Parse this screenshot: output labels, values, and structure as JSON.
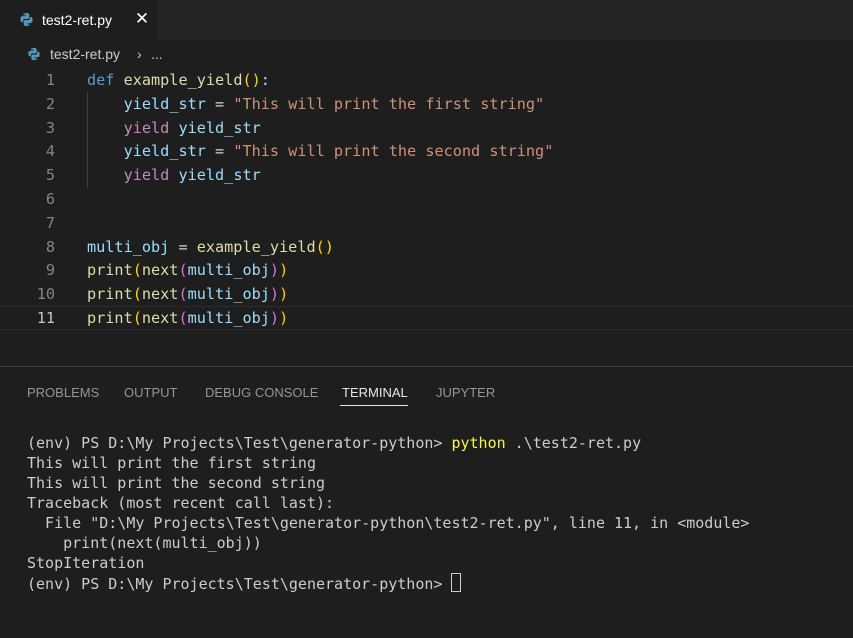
{
  "tab": {
    "label": "test2-ret.py",
    "close_glyph": "✕",
    "icon": "python-icon"
  },
  "breadcrumb": {
    "file": "test2-ret.py",
    "separator": "›",
    "more": "..."
  },
  "editor": {
    "line_numbers": [
      "1",
      "2",
      "3",
      "4",
      "5",
      "6",
      "7",
      "8",
      "9",
      "10",
      "11"
    ],
    "active_line": "11",
    "lines": [
      [
        [
          "kw-def",
          "def"
        ],
        [
          "op",
          " "
        ],
        [
          "fn",
          "example_yield"
        ],
        [
          "br1",
          "()"
        ],
        [
          "op",
          ":"
        ]
      ],
      [
        [
          "op",
          "    "
        ],
        [
          "var",
          "yield_str"
        ],
        [
          "op",
          " = "
        ],
        [
          "str",
          "\"This will print the first string\""
        ]
      ],
      [
        [
          "op",
          "    "
        ],
        [
          "kw-flow",
          "yield"
        ],
        [
          "op",
          " "
        ],
        [
          "var",
          "yield_str"
        ]
      ],
      [
        [
          "op",
          "    "
        ],
        [
          "var",
          "yield_str"
        ],
        [
          "op",
          " = "
        ],
        [
          "str",
          "\"This will print the second string\""
        ]
      ],
      [
        [
          "op",
          "    "
        ],
        [
          "kw-flow",
          "yield"
        ],
        [
          "op",
          " "
        ],
        [
          "var",
          "yield_str"
        ]
      ],
      [],
      [],
      [
        [
          "var",
          "multi_obj"
        ],
        [
          "op",
          " = "
        ],
        [
          "fn",
          "example_yield"
        ],
        [
          "br1",
          "()"
        ]
      ],
      [
        [
          "fn",
          "print"
        ],
        [
          "br1",
          "("
        ],
        [
          "fn",
          "next"
        ],
        [
          "br2",
          "("
        ],
        [
          "var",
          "multi_obj"
        ],
        [
          "br2",
          ")"
        ],
        [
          "br1",
          ")"
        ]
      ],
      [
        [
          "fn",
          "print"
        ],
        [
          "br1",
          "("
        ],
        [
          "fn",
          "next"
        ],
        [
          "br2",
          "("
        ],
        [
          "var",
          "multi_obj"
        ],
        [
          "br2",
          ")"
        ],
        [
          "br1",
          ")"
        ]
      ],
      [
        [
          "fn",
          "print"
        ],
        [
          "br1",
          "("
        ],
        [
          "fn",
          "next"
        ],
        [
          "br2",
          "("
        ],
        [
          "var",
          "multi_obj"
        ],
        [
          "br2",
          ")"
        ],
        [
          "br1",
          ")"
        ]
      ]
    ]
  },
  "panel": {
    "tabs": {
      "problems": "PROBLEMS",
      "output": "OUTPUT",
      "debug_console": "DEBUG CONSOLE",
      "terminal": "TERMINAL",
      "jupyter": "JUPYTER"
    },
    "active_tab": "TERMINAL"
  },
  "terminal": {
    "prompt1": "(env) PS D:\\My Projects\\Test\\generator-python> ",
    "command": "python",
    "command_args": " .\\test2-ret.py",
    "output": [
      "This will print the first string",
      "This will print the second string",
      "Traceback (most recent call last):",
      "  File \"D:\\My Projects\\Test\\generator-python\\test2-ret.py\", line 11, in <module>",
      "    print(next(multi_obj))",
      "StopIteration"
    ],
    "prompt2": "(env) PS D:\\My Projects\\Test\\generator-python> "
  },
  "colors": {
    "editor_bg": "#1e1e1e",
    "tabbar_bg": "#252526",
    "keyword": "#569cd6",
    "control_keyword": "#c586c0",
    "function": "#dcdcaa",
    "variable": "#9cdcfe",
    "string": "#ce9178",
    "terminal_command": "#f5f543"
  }
}
